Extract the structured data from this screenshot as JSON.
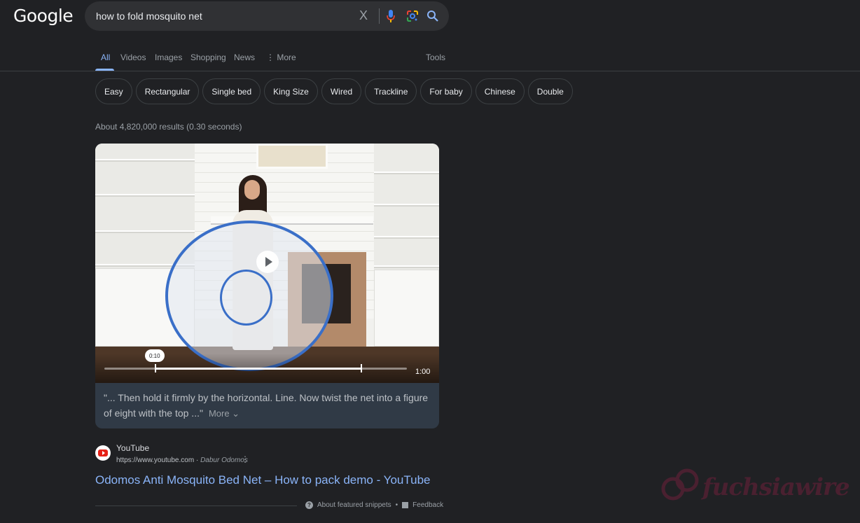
{
  "logo": "Google",
  "search": {
    "query": "how to fold mosquito net",
    "clear_symbol": "X"
  },
  "tabs": [
    {
      "label": "All",
      "active": true
    },
    {
      "label": "Videos"
    },
    {
      "label": "Images"
    },
    {
      "label": "Shopping"
    },
    {
      "label": "News"
    },
    {
      "label": "⋮ More"
    }
  ],
  "tools_label": "Tools",
  "chips": [
    "Easy",
    "Rectangular",
    "Single bed",
    "King Size",
    "Wired",
    "Trackline",
    "For baby",
    "Chinese",
    "Double"
  ],
  "result_stats": "About 4,820,000 results (0.30 seconds)",
  "video": {
    "current_time": "0:10",
    "duration": "1:00",
    "transcript": "\"... Then hold it firmly by the horizontal. Line. Now twist the net into a figure of eight with the top ...\"",
    "more_label": "More ⌄"
  },
  "source": {
    "name": "YouTube",
    "url": "https://www.youtube.com",
    "separator": " · ",
    "channel": "Dabur Odomos"
  },
  "result_title": "Odomos Anti Mosquito Bed Net – How to pack demo - YouTube",
  "footer": {
    "about_label": "About featured snippets",
    "dot": "•",
    "feedback_label": "Feedback"
  },
  "watermark": "fuchsiawire",
  "colors": {
    "background": "#202124",
    "link": "#8ab4f8",
    "accent_tab": "#8ab4f8"
  }
}
